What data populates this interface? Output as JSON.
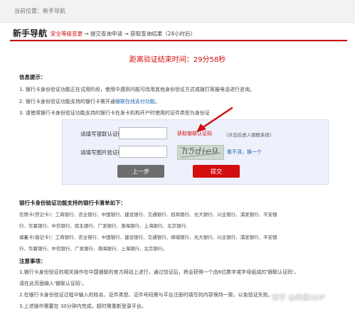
{
  "breadcrumb": "当前位置：新手导航",
  "header": {
    "title": "新手导航",
    "step1": "安全等级变更",
    "sep": " → ",
    "step2": "提交查询申请",
    "step3": "获取查询结果",
    "step3_note": "（24小时后）"
  },
  "countdown": {
    "label": "距离验证结束时间：",
    "value": "29分58秒"
  },
  "info": {
    "title": "信息提示：",
    "line1": "1. 银行卡身份验证功能正在试用阶段，使用中遇到问题可改用其他身份验证方式或拨打客服电话进行咨询。",
    "line2_prefix": "2. 银行卡身份验证功能支持的银行卡需开通",
    "line2_link": "银联在线支付功能",
    "line2_suffix": "。",
    "line3": "3. 请使用银行卡身份验证功能支持的银行卡在发卡机构开户时使用的证件类型为身份证"
  },
  "form": {
    "unionpay_code_label": "请填写银联认证码：",
    "unionpay_code_value": "",
    "get_code_link": "获取银联认证码",
    "get_code_hint": "（点击后进入银联系统）",
    "captcha_label": "请填写图片验证码：",
    "captcha_value": "",
    "captcha_image_text": "h5die9",
    "refresh_link": "看不清，换一个",
    "back_button": "上一步",
    "submit_button": "提交"
  },
  "banks": {
    "title": "银行卡身份验证功能支持的银行卡清单如下：",
    "credit_line1": "信用卡(贷记卡)：工商银行、农业银行、中国银行、建设银行、交通银行、招商银行、光大银行、兴业银行、浦发银行、平安银",
    "credit_line2": "行、华夏银行、中信银行、民生银行、广发银行、渤海银行、上海银行、北京银行;",
    "debit_line1": "储蓄卡(借记卡)：工商银行、农业银行、中国银行、建设银行、交通银行、邮储银行、光大银行、兴业银行、浦发银行、平安银",
    "debit_line2": "行、华夏银行、中信银行、广发银行、渤海银行、上海银行、北京银行。"
  },
  "notes": {
    "title": "注意事项：",
    "line1": "1.银行卡身份验证的相关操作在中国银联的官方网站上进行，通过验证后，将会获得一个由6位数字或字母组成的'银联认证码'，",
    "line2": "请在此页面输入'银联认证码'。",
    "line3": "2.在银行卡身份验证过程中输入的姓名、证件类型、证件号码需与平台注册时填写的内容保持一致，以免验证失败。",
    "line4": "3.上述操作需要在 30分钟内完成，超时需重新登录平台。"
  },
  "watermark": "知乎 @绝赢GDP",
  "colors": {
    "accent_red": "#d30e0e",
    "link_blue": "#1a5fb4",
    "form_bg": "#eef1fb"
  }
}
